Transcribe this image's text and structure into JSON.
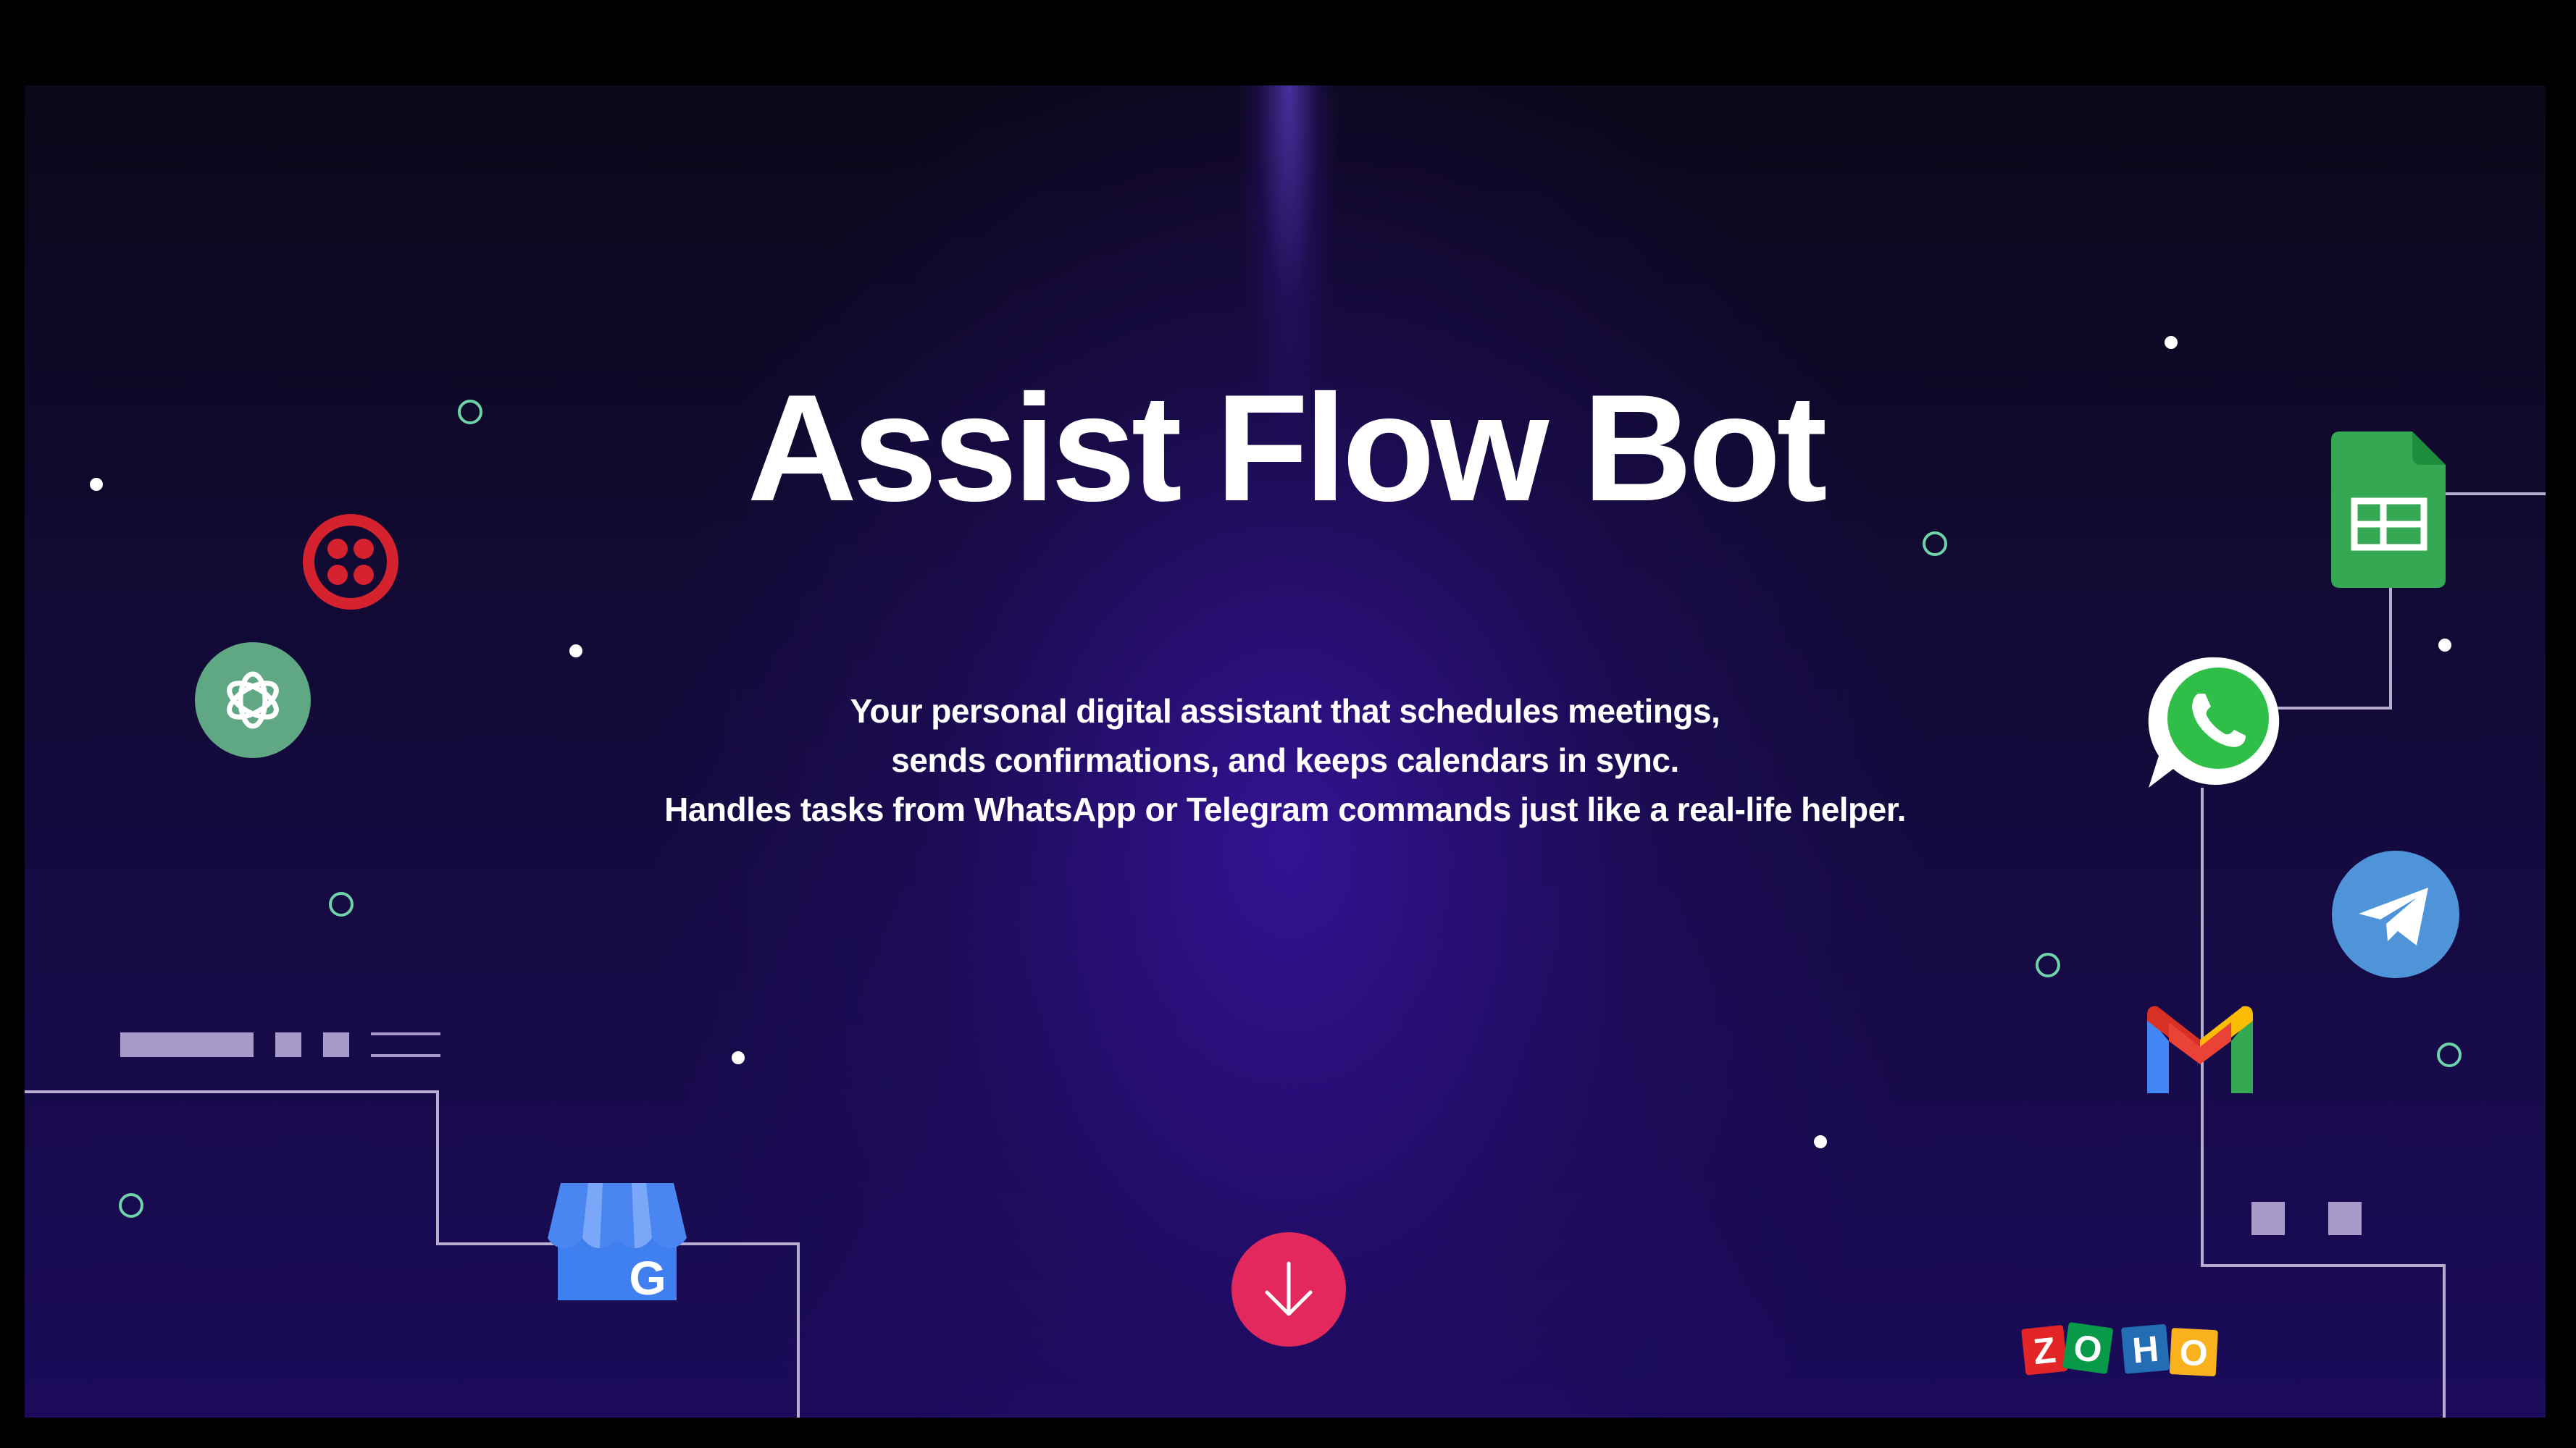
{
  "hero": {
    "title": "Assist Flow Bot",
    "subtitle_lines": [
      "Your personal digital assistant that schedules meetings,",
      "sends confirmations, and keeps calendars in sync.",
      "Handles tasks from WhatsApp or Telegram commands just like a real-life helper."
    ]
  },
  "icons": {
    "twilio": "twilio-icon",
    "openai": "openai-icon",
    "google_business": "google-my-business-icon",
    "google_sheets": "google-sheets-icon",
    "whatsapp": "whatsapp-icon",
    "telegram": "telegram-icon",
    "gmail": "gmail-icon",
    "zoho": "zoho-logo",
    "scroll_down": "arrow-down-icon"
  },
  "zoho_letters": [
    "Z",
    "O",
    "H",
    "O"
  ],
  "google_business_letter": "G",
  "colors": {
    "accent": "#e2285c",
    "ring": "#6ed3a9",
    "twilio": "#d5222e",
    "openai": "#5fa883",
    "sheets": "#34a853",
    "whatsapp": "#2fbf48",
    "telegram": "#4f94d9"
  }
}
